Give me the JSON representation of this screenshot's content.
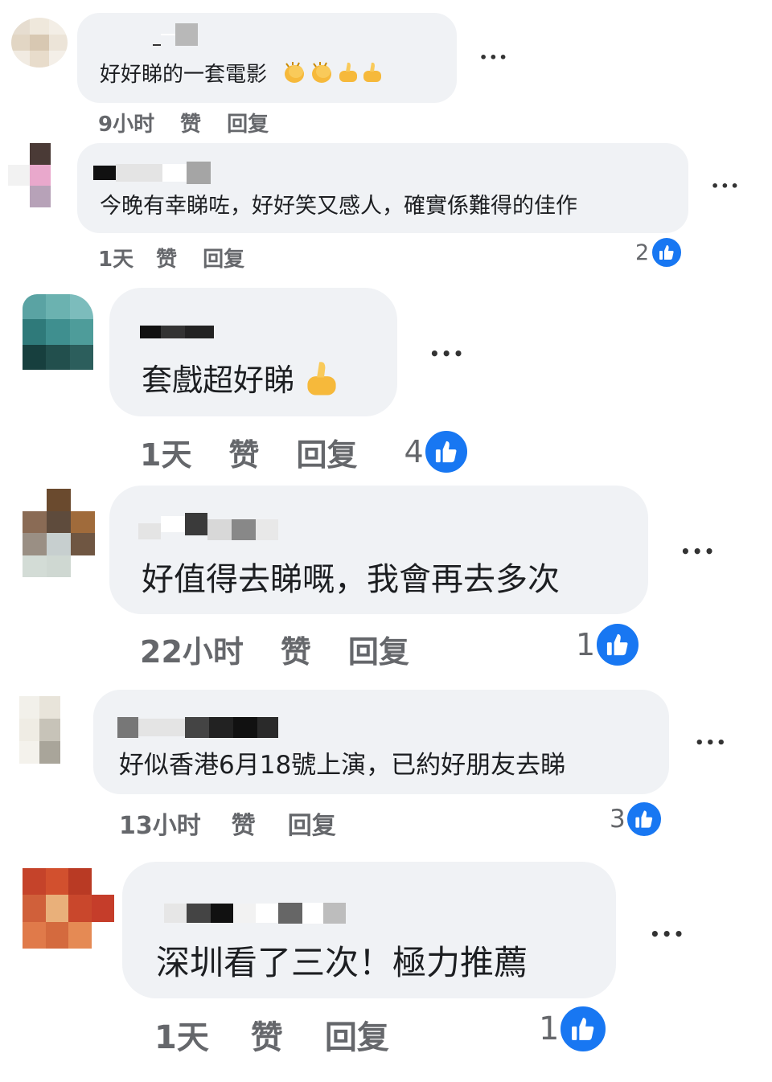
{
  "comments": [
    {
      "text": "好好睇的一套電影",
      "emojis": [
        "clap-emoji",
        "clap-emoji",
        "thumbs-up-emoji",
        "thumbs-up-emoji"
      ],
      "time": "9小时",
      "like_label": "赞",
      "reply_label": "回复",
      "reaction_count": ""
    },
    {
      "text": "今晚有幸睇咗，好好笑又感人，確實係難得的佳作",
      "emojis": [],
      "time": "1天",
      "like_label": "赞",
      "reply_label": "回复",
      "reaction_count": "2"
    },
    {
      "text": "套戲超好睇",
      "emojis": [
        "thumbs-up-emoji"
      ],
      "time": "1天",
      "like_label": "赞",
      "reply_label": "回复",
      "reaction_count": "4"
    },
    {
      "text": "好值得去睇嘅，我會再去多次",
      "emojis": [],
      "time": "22小时",
      "like_label": "赞",
      "reply_label": "回复",
      "reaction_count": "1"
    },
    {
      "text": "好似香港6月18號上演，已約好朋友去睇",
      "emojis": [],
      "time": "13小时",
      "like_label": "赞",
      "reply_label": "回复",
      "reaction_count": "3"
    },
    {
      "text": "深圳看了三次！極力推薦",
      "emojis": [],
      "time": "1天",
      "like_label": "赞",
      "reply_label": "回复",
      "reaction_count": "1"
    }
  ],
  "more_label": "•••",
  "colors": {
    "bubble": "#f0f2f5",
    "like_blue": "#1877f2",
    "meta_gray": "#65676b"
  }
}
